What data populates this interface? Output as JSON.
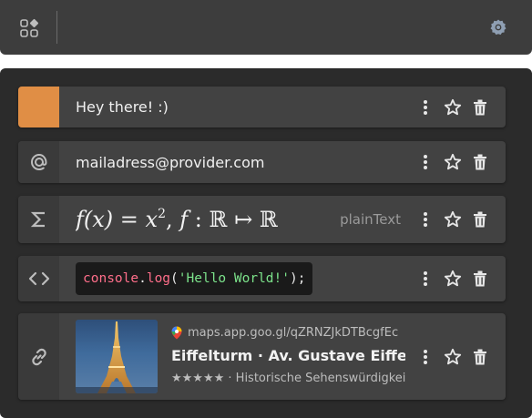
{
  "toolbar": {
    "apps_icon": "apps-grid-icon",
    "settings_icon": "gear-icon"
  },
  "clips": [
    {
      "kind": "text",
      "accent": "#e08e45",
      "text": "Hey there! :)"
    },
    {
      "kind": "email",
      "icon": "at-sign-icon",
      "text": "mailadress@provider.com"
    },
    {
      "kind": "math",
      "icon": "sigma-icon",
      "badge": "plainText"
    },
    {
      "kind": "code",
      "icon": "code-brackets-icon",
      "tokens": {
        "obj": "console",
        "dot": ".",
        "fn": "log",
        "open": "(",
        "str": "'Hello World!'",
        "close": ");"
      }
    },
    {
      "kind": "link",
      "icon": "link-icon",
      "url": "maps.app.goo.gl/qZRNZJkDTBcgfEc",
      "title": "Eiffelturm · Av. Gustave Eiffel, ...",
      "description": "★★★★★ · Historische Sehenswürdigkeit"
    }
  ],
  "actions": {
    "more_icon": "more-vertical-icon",
    "favorite_icon": "star-icon",
    "delete_icon": "trash-icon"
  }
}
